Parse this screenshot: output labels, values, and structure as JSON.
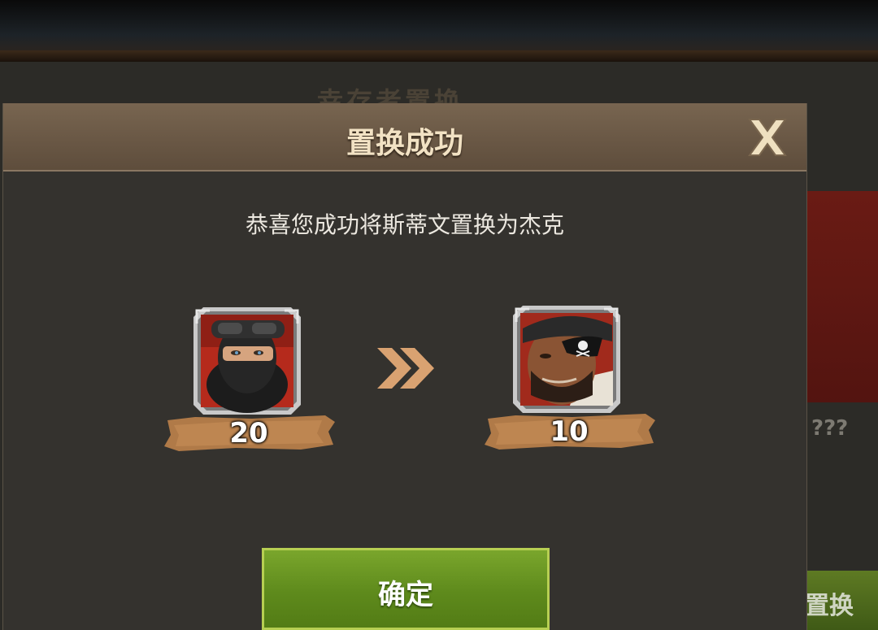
{
  "background": {
    "title": "幸存者置换",
    "card_placeholder": "???",
    "action_label": "置换"
  },
  "modal": {
    "title": "置换成功",
    "close_icon": "close-x-icon",
    "message": "恭喜您成功将斯蒂文置换为杰克",
    "from_hero": {
      "level": "20",
      "portrait_icon": "masked-soldier-portrait"
    },
    "to_hero": {
      "level": "10",
      "portrait_icon": "pirate-eyepatch-portrait"
    },
    "arrow_icon": "double-chevron-right-icon",
    "confirm_label": "确定"
  },
  "colors": {
    "header": "#6b5846",
    "title_text": "#f2e2c4",
    "confirm_green": "#6a9624",
    "banner": "#b07a48",
    "arrow": "#d9a271"
  }
}
